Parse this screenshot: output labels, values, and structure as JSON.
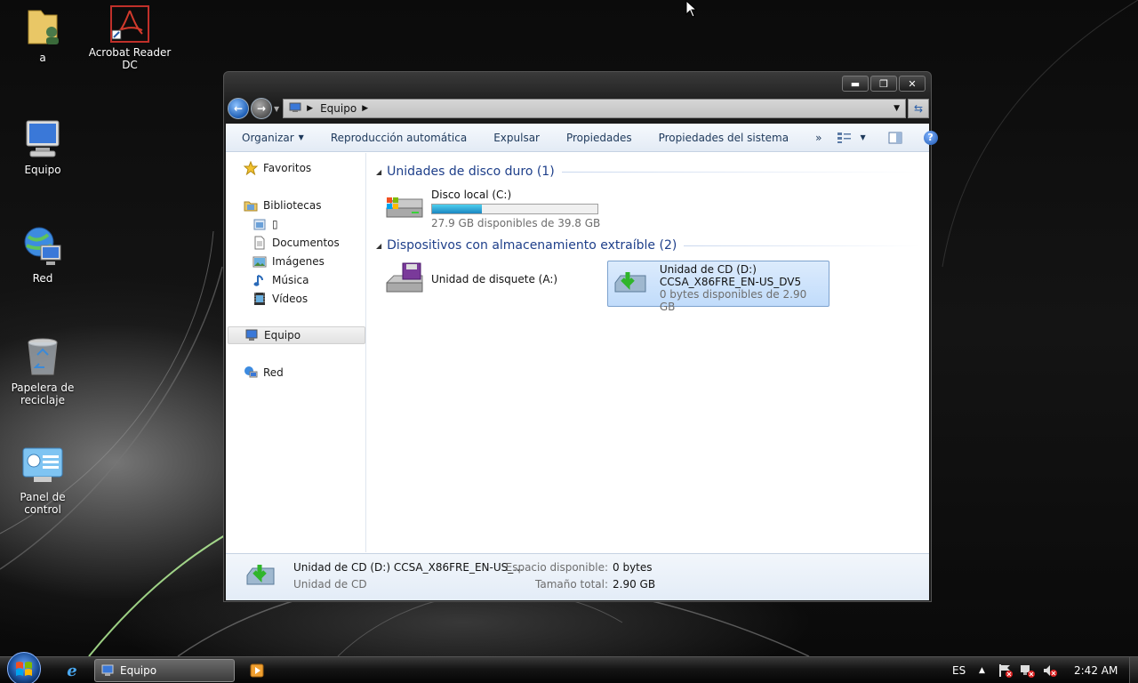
{
  "desktop": {
    "icons": [
      {
        "label": "a",
        "icon": "user-folder-icon"
      },
      {
        "label": "Acrobat Reader DC",
        "icon": "acrobat-reader-icon"
      },
      {
        "label": "Equipo",
        "icon": "computer-icon"
      },
      {
        "label": "Red",
        "icon": "network-icon"
      },
      {
        "label": "Papelera de reciclaje",
        "icon": "recycle-bin-icon"
      },
      {
        "label": "Panel de control",
        "icon": "control-panel-icon"
      }
    ]
  },
  "window": {
    "controls": {
      "minimize": "▬",
      "maximize": "❐",
      "close": "✕"
    },
    "address": {
      "crumb": "Equipo"
    },
    "toolbar": {
      "organize": "Organizar",
      "autoplay": "Reproducción automática",
      "eject": "Expulsar",
      "properties": "Propiedades",
      "system_properties": "Propiedades del sistema",
      "more": "»"
    },
    "nav_pane": {
      "favorites": "Favoritos",
      "libraries": "Bibliotecas",
      "lib_unnamed": "▯",
      "documents": "Documentos",
      "images": "Imágenes",
      "music": "Música",
      "videos": "Vídeos",
      "computer": "Equipo",
      "network": "Red"
    },
    "groups": {
      "hard_disks": "Unidades de disco duro (1)",
      "removable": "Dispositivos con almacenamiento extraíble (2)"
    },
    "drives": {
      "c": {
        "name": "Disco local (C:)",
        "free": "27.9 GB disponibles de 39.8 GB",
        "used_fraction": 0.3
      },
      "a": {
        "name": "Unidad de disquete (A:)"
      },
      "d": {
        "name": "Unidad de CD (D:)",
        "label": "CCSA_X86FRE_EN-US_DV5",
        "free": "0 bytes disponibles de 2.90 GB"
      }
    },
    "details": {
      "title": "Unidad de CD (D:) CCSA_X86FRE_EN-US_...",
      "type": "Unidad de CD",
      "free_label": "Espacio disponible:",
      "free_value": "0 bytes",
      "total_label": "Tamaño total:",
      "total_value": "2.90 GB"
    }
  },
  "taskbar": {
    "active_window": "Equipo",
    "language": "ES",
    "time": "2:42 AM"
  }
}
